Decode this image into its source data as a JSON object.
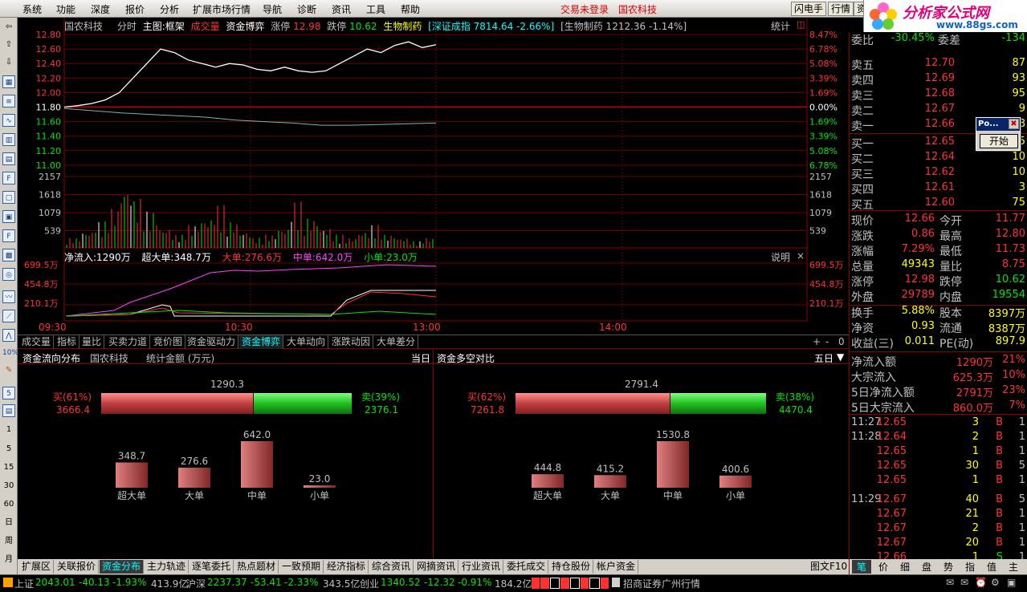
{
  "menu": {
    "items": [
      "系统",
      "功能",
      "深度",
      "报价",
      "分析",
      "扩展市场行情",
      "导航",
      "诊断",
      "资讯",
      "工具",
      "帮助"
    ],
    "alert1": "交易未登录",
    "alert2": "国农科技",
    "btn_flash": "闪电手",
    "btn_quote": "行情",
    "btn_more": "资"
  },
  "logo": {
    "text": "分析家公式网",
    "url": "www.88gs.com"
  },
  "toolbar": {
    "nums": [
      "10%",
      "1",
      "5",
      "15",
      "30",
      "60",
      "日",
      "周",
      "月"
    ]
  },
  "chart": {
    "stock": "国农科技",
    "type": "分时",
    "main": "主图:框架",
    "vol": "成交量",
    "capital": "资金博弈",
    "limit_up_label": "涨停",
    "limit_up": "12.98",
    "limit_down_label": "跌停",
    "limit_down": "10.62",
    "sector": "生物制药",
    "index_info": "[深证成指 7814.64 -2.66%]",
    "sector_info": "[生物制药 1212.36 -1.14%]",
    "stat": "统计",
    "price_ticks": [
      "12.80",
      "12.60",
      "12.40",
      "12.20",
      "12.00",
      "11.80",
      "11.60",
      "11.40",
      "11.20",
      "11.00"
    ],
    "pct_ticks": [
      "8.47%",
      "6.78%",
      "5.08%",
      "3.39%",
      "1.69%",
      "0.00%",
      "1.69%",
      "3.39%",
      "5.08%",
      "6.78%"
    ],
    "vol_ticks": [
      "2157",
      "1618",
      "1079",
      "539"
    ],
    "flow_title": "净流入:1290万",
    "flow_super": "超大单:348.7万",
    "flow_big": "大单:276.6万",
    "flow_mid": "中单:642.0万",
    "flow_small": "小单:23.0万",
    "flow_note": "说明",
    "flow_close": "×",
    "flow_ticks": [
      "699.5万",
      "454.8万",
      "210.1万"
    ],
    "times": [
      "09:30",
      "10:30",
      "13:00",
      "14:00"
    ]
  },
  "chart_data": {
    "type": "line",
    "title": "国农科技 分时",
    "ylim": [
      11.0,
      12.8
    ],
    "price_line": [
      11.8,
      11.82,
      11.85,
      11.9,
      12.0,
      12.2,
      12.4,
      12.6,
      12.55,
      12.45,
      12.4,
      12.35,
      12.4,
      12.38,
      12.32,
      12.3,
      12.35,
      12.3,
      12.28,
      12.3,
      12.4,
      12.5,
      12.6,
      12.55,
      12.65,
      12.7,
      12.62,
      12.66
    ],
    "avg_line": [
      11.78,
      11.75,
      11.72,
      11.7,
      11.68,
      11.66,
      11.62,
      11.6,
      11.58,
      11.55,
      11.55,
      11.56,
      11.57,
      11.58
    ],
    "volume": [
      300,
      500,
      800,
      1200,
      1900,
      1500,
      1100,
      600,
      400,
      700,
      900,
      1300,
      800,
      500,
      300,
      400,
      600,
      1400,
      900,
      600,
      400,
      300,
      500,
      700,
      400,
      300,
      200,
      300
    ]
  },
  "subtabs": [
    "成交量",
    "指标",
    "量比",
    "买卖力道",
    "竞价图",
    "资金驱动力",
    "资金博弈",
    "大单动向",
    "涨跌动因",
    "大单差分"
  ],
  "subtabs_active": 6,
  "bottom_left": {
    "title": "资金流向分布",
    "stock": "国农科技",
    "stat": "统计金额 (万元)",
    "period": "当日",
    "net": "1290.3",
    "buy_label": "买(61%)",
    "buy_val": "3666.4",
    "sell_label": "卖(39%)",
    "sell_val": "2376.1",
    "bars": [
      {
        "label": "超大单",
        "value": "348.7",
        "v": 348.7
      },
      {
        "label": "大单",
        "value": "276.6",
        "v": 276.6
      },
      {
        "label": "中单",
        "value": "642.0",
        "v": 642.0
      },
      {
        "label": "小单",
        "value": "23.0",
        "v": 23.0
      }
    ]
  },
  "bottom_right": {
    "title": "资金多空对比",
    "period": "五日",
    "net": "2791.4",
    "buy_label": "买(62%)",
    "buy_val": "7261.8",
    "sell_label": "卖(38%)",
    "sell_val": "4470.4",
    "bars": [
      {
        "label": "超大单",
        "value": "444.8",
        "v": 444.8
      },
      {
        "label": "大单",
        "value": "415.2",
        "v": 415.2
      },
      {
        "label": "中单",
        "value": "1530.8",
        "v": 1530.8
      },
      {
        "label": "小单",
        "value": "400.6",
        "v": 400.6
      }
    ]
  },
  "bottom_tabs": [
    "扩展区",
    "关联报价",
    "资金分布",
    "主力轨迹",
    "逐笔委托",
    "热点题材",
    "一致预期",
    "经济指标",
    "综合资讯",
    "网摘资讯",
    "行业资讯",
    "委托成交",
    "持仓股份",
    "帐户资金"
  ],
  "bottom_tabs_active": 2,
  "quote": {
    "wb_label": "委比",
    "wb": "-30.45%",
    "wc_label": "委差",
    "wc": "-134",
    "sell": [
      {
        "l": "卖五",
        "p": "12.70",
        "v": "87"
      },
      {
        "l": "卖四",
        "p": "12.69",
        "v": "93"
      },
      {
        "l": "卖三",
        "p": "12.68",
        "v": "95"
      },
      {
        "l": "卖二",
        "p": "12.67",
        "v": "9"
      },
      {
        "l": "卖一",
        "p": "12.66",
        "v": "8"
      }
    ],
    "buy": [
      {
        "l": "买一",
        "p": "12.65",
        "v": "5"
      },
      {
        "l": "买二",
        "p": "12.64",
        "v": "10"
      },
      {
        "l": "买三",
        "p": "12.62",
        "v": "10"
      },
      {
        "l": "买四",
        "p": "12.61",
        "v": "3"
      },
      {
        "l": "买五",
        "p": "12.60",
        "v": "75"
      }
    ],
    "stats": [
      [
        "现价",
        "12.66",
        "今开",
        "11.77"
      ],
      [
        "涨跌",
        "0.86",
        "最高",
        "12.80"
      ],
      [
        "涨幅",
        "7.29%",
        "最低",
        "11.73"
      ],
      [
        "总量",
        "49343",
        "量比",
        "8.75"
      ],
      [
        "涨停",
        "12.98",
        "跌停",
        "10.62"
      ],
      [
        "外盘",
        "29789",
        "内盘",
        "19554"
      ]
    ],
    "stats2": [
      [
        "换手",
        "5.88%",
        "股本",
        "8397万"
      ],
      [
        "净资",
        "0.93",
        "流通",
        "8387万"
      ],
      [
        "收益(三)",
        "0.011",
        "PE(动)",
        "897.9"
      ]
    ],
    "flows": [
      [
        "净流入额",
        "1290万",
        "21%"
      ],
      [
        "大宗流入",
        "625.3万",
        "10%"
      ],
      [
        "5日净流入额",
        "2791万",
        "23%"
      ],
      [
        "5日大宗流入",
        "860.0万",
        "7%"
      ]
    ],
    "ticks": [
      [
        "11:27",
        "12.65",
        "3",
        "B"
      ],
      [
        "11:28",
        "12.64",
        "2",
        "B"
      ],
      [
        "",
        "12.65",
        "1",
        "B"
      ],
      [
        "",
        "12.65",
        "30",
        "B"
      ],
      [
        "",
        "12.65",
        "1",
        "B"
      ],
      [
        "11:29",
        "12.67",
        "40",
        "B"
      ],
      [
        "",
        "12.67",
        "21",
        "B"
      ],
      [
        "",
        "12.67",
        "2",
        "B"
      ],
      [
        "",
        "12.67",
        "20",
        "B"
      ],
      [
        "",
        "12.66",
        "1",
        "S"
      ]
    ],
    "side_nums": [
      "1",
      "1",
      "1",
      "5",
      "1",
      "5",
      "1",
      "1",
      "1",
      "1"
    ],
    "right_tabs": [
      "笔",
      "价",
      "细",
      "盘",
      "势",
      "指",
      "值",
      "主"
    ]
  },
  "popup": {
    "title": "Po...",
    "button": "开始"
  },
  "status": {
    "sh_label": "上证",
    "sh": "2043.01",
    "sh_chg": "-40.13",
    "sh_pct": "-1.93%",
    "sh_amt": "413.9亿",
    "sz_label": "沪深",
    "sz": "2237.37",
    "sz_chg": "-53.41",
    "sz_pct": "-2.33%",
    "sz_amt": "343.5亿",
    "cy_label": "创业",
    "cy": "1340.52",
    "cy_chg": "-12.32",
    "cy_pct": "-0.91%",
    "cy_amt": "184.2亿",
    "broker": "招商证券广州行情"
  },
  "misc": {
    "tuwen": "图文F10",
    "plus": "+",
    "minus": "-",
    "zero": "0"
  },
  "colors": {
    "up": "#ff3232",
    "down": "#00e600",
    "grid": "#8b0000",
    "accent": "#00ffff"
  }
}
